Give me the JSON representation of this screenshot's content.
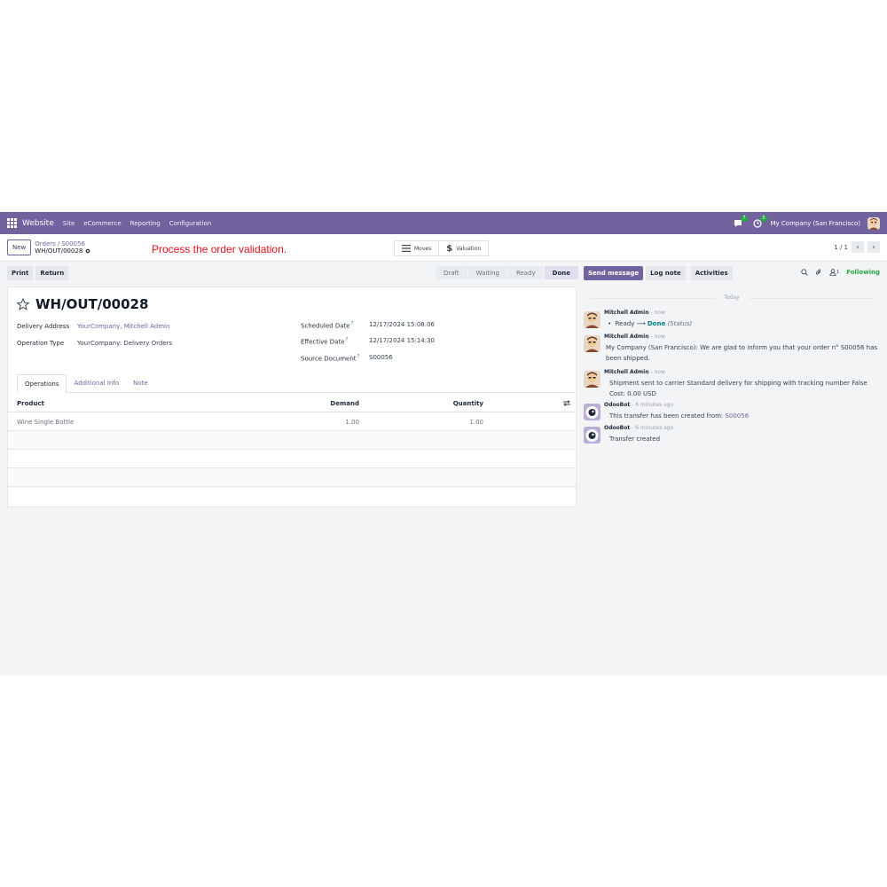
{
  "navbar": {
    "app_name": "Website",
    "menu": [
      "Site",
      "eCommerce",
      "Reporting",
      "Configuration"
    ],
    "messages_count": "7",
    "activities_count": "5",
    "company": "My Company (San Francisco)"
  },
  "control_panel": {
    "new_label": "New",
    "breadcrumb_parent": "Orders",
    "breadcrumb_mid": "S00056",
    "breadcrumb_current": "WH/OUT/00028",
    "instruction": "Process the order validation.",
    "smart_moves": "Moves",
    "smart_valuation": "Valuation",
    "pager": "1 / 1"
  },
  "actions": {
    "print": "Print",
    "return": "Return"
  },
  "statusbar": [
    "Draft",
    "Waiting",
    "Ready",
    "Done"
  ],
  "statusbar_active": "Done",
  "record": {
    "title": "WH/OUT/00028",
    "delivery_address_label": "Delivery Address",
    "delivery_address": "YourCompany, Mitchell Admin",
    "operation_type_label": "Operation Type",
    "operation_type": "YourCompany: Delivery Orders",
    "scheduled_date_label": "Scheduled Date",
    "scheduled_date": "12/17/2024 15:08:06",
    "effective_date_label": "Effective Date",
    "effective_date": "12/17/2024 15:14:30",
    "source_document_label": "Source Document",
    "source_document": "S00056",
    "help_mark": "?"
  },
  "tabs": [
    "Operations",
    "Additional Info",
    "Note"
  ],
  "table": {
    "headers": [
      "Product",
      "Demand",
      "Quantity"
    ],
    "rows": [
      {
        "product": "Wine Single Bottle",
        "demand": "1.00",
        "quantity": "1.00"
      }
    ]
  },
  "chatter": {
    "send_message": "Send message",
    "log_note": "Log note",
    "activities": "Activities",
    "followers_count": "1",
    "following": "Following",
    "today": "Today",
    "messages": [
      {
        "author": "Mitchell Admin",
        "date": " - now",
        "from": "Ready",
        "arrow": "⟶",
        "to": "Done",
        "field": "(Status)"
      },
      {
        "author": "Mitchell Admin",
        "date": " - now",
        "line1": "My Company (San Francisco): We are glad to inform you that your order n° S00056 has",
        "line2": "been shipped."
      },
      {
        "author": "Mitchell Admin",
        "date": " - now",
        "line1": "Shipment sent to carrier Standard delivery for shipping with tracking number False",
        "line2": "Cost: 0.00 USD"
      },
      {
        "author": "OdooBot",
        "date": " - 6 minutes ago",
        "line1": "This transfer has been created from: ",
        "link": "S00056"
      },
      {
        "author": "OdooBot",
        "date": " - 6 minutes ago",
        "line1": "Transfer created"
      }
    ]
  },
  "colors": {
    "brand": "#71639e",
    "instruction": "#e3111d",
    "following": "#28a745",
    "link": "#017e84"
  }
}
